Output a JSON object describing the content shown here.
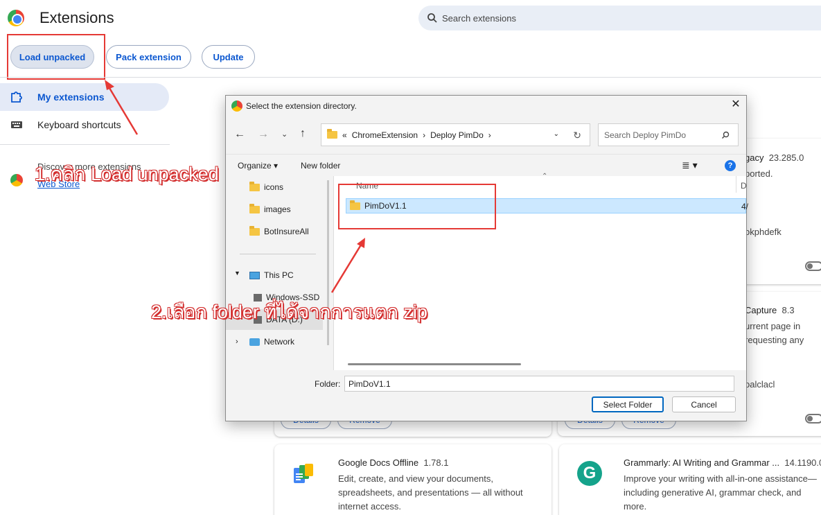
{
  "app": {
    "title": "Extensions"
  },
  "search": {
    "placeholder": "Search extensions"
  },
  "toolbar": {
    "load_unpacked": "Load unpacked",
    "pack_extension": "Pack extension",
    "update": "Update"
  },
  "sidebar": {
    "items": [
      {
        "label": "My extensions",
        "icon": "puzzle-icon"
      },
      {
        "label": "Keyboard shortcuts",
        "icon": "keyboard-icon"
      }
    ],
    "discover_text": "Discover more extensions",
    "discover_link": "Web Store"
  },
  "cards": {
    "top_right": {
      "name_partial": "gacy",
      "version": "23.285.0",
      "desc": "ported.",
      "id_partial": "okphdefk"
    },
    "mid_right": {
      "name_partial": "Capture",
      "version": "8.3",
      "desc1": "urrent page in",
      "desc2": "requesting any",
      "id_partial": "oalclacl"
    },
    "details_label": "Details",
    "remove_label": "Remove",
    "google_docs": {
      "name": "Google Docs Offline",
      "version": "1.78.1",
      "desc": "Edit, create, and view your documents, spreadsheets, and presentations — all without internet access."
    },
    "grammarly": {
      "name": "Grammarly: AI Writing and Grammar ...",
      "version": "14.1190.0",
      "desc": "Improve your writing with all-in-one assistance—including generative AI, grammar check, and more."
    }
  },
  "dialog": {
    "title": "Select the extension directory.",
    "path": [
      "ChromeExtension",
      "Deploy PimDo"
    ],
    "path_prefix": "«",
    "search_placeholder": "Search Deploy PimDo",
    "organize": "Organize",
    "new_folder": "New folder",
    "tree": [
      "icons",
      "images",
      "BotInsureAll",
      "This PC",
      "Windows-SSD",
      "DATA (D:)",
      "Network"
    ],
    "column_name": "Name",
    "column_date": "D",
    "files": [
      {
        "name": "PimDoV1.1",
        "date_partial": "4/"
      }
    ],
    "folder_label": "Folder:",
    "folder_value": "PimDoV1.1",
    "select_button": "Select Folder",
    "cancel_button": "Cancel"
  },
  "annotations": {
    "step1": "1.คลิก Load unpacked",
    "step2": "2.เลือก folder ที่ได้จากการแตก zip"
  },
  "colors": {
    "accent": "#0b57d0",
    "annotation_red": "#e53935",
    "selection": "#cce8ff"
  }
}
